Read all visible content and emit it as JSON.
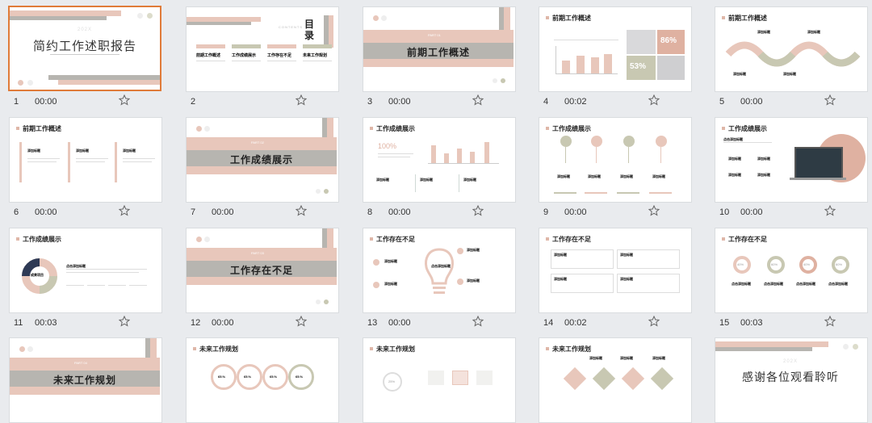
{
  "slides": [
    {
      "num": "1",
      "time": "00:00",
      "title": "简约工作述职报告",
      "year": "202X"
    },
    {
      "num": "2",
      "time": "",
      "title": "目录",
      "subtitle": "CONTENTS",
      "items": [
        "前期工作概述",
        "工作成绩展示",
        "工作存在不足",
        "未来工作规划"
      ],
      "tabs": [
        "01",
        "02",
        "03",
        "04"
      ]
    },
    {
      "num": "3",
      "time": "00:00",
      "title": "前期工作概述",
      "badge": "PART 01"
    },
    {
      "num": "4",
      "time": "00:02",
      "title": "前期工作概述",
      "pct1": "86%",
      "pct2": "53%"
    },
    {
      "num": "5",
      "time": "00:00",
      "title": "前期工作概述",
      "labels": [
        "添加标题",
        "添加标题",
        "添加标题",
        "添加标题"
      ]
    },
    {
      "num": "6",
      "time": "00:00",
      "title": "前期工作概述",
      "labels": [
        "添加标题",
        "添加标题",
        "添加标题"
      ]
    },
    {
      "num": "7",
      "time": "00:00",
      "title": "工作成绩展示",
      "badge": "PART 02"
    },
    {
      "num": "8",
      "time": "00:00",
      "title": "工作成绩展示",
      "big": "100%",
      "labels": [
        "添加标题",
        "添加标题",
        "添加标题"
      ]
    },
    {
      "num": "9",
      "time": "00:00",
      "title": "工作成绩展示",
      "labels": [
        "添加标题",
        "添加标题",
        "添加标题",
        "添加标题"
      ]
    },
    {
      "num": "10",
      "time": "00:00",
      "title": "工作成绩展示",
      "labels": [
        "点击添加标题",
        "添加标题",
        "添加标题",
        "添加标题",
        "添加标题"
      ]
    },
    {
      "num": "11",
      "time": "00:03",
      "title": "工作成绩展示",
      "center": "成果项目",
      "label": "点击添加标题"
    },
    {
      "num": "12",
      "time": "00:00",
      "title": "工作存在不足",
      "badge": "PART 03"
    },
    {
      "num": "13",
      "time": "00:00",
      "title": "工作存在不足",
      "center": "点击添加标题",
      "labels": [
        "添加标题",
        "添加标题",
        "添加标题",
        "添加标题"
      ]
    },
    {
      "num": "14",
      "time": "00:02",
      "title": "工作存在不足",
      "labels": [
        "添加标题",
        "添加标题",
        "添加标题",
        "添加标题"
      ]
    },
    {
      "num": "15",
      "time": "00:03",
      "title": "工作存在不足",
      "pcts": [
        "40%",
        "60%",
        "40%",
        "60%"
      ],
      "labels": [
        "点击添加标题",
        "点击添加标题",
        "点击添加标题",
        "点击添加标题"
      ]
    },
    {
      "num": "",
      "time": "",
      "title": "未来工作规划",
      "badge": "PART 04"
    },
    {
      "num": "",
      "time": "",
      "title": "未来工作规划",
      "pcts": [
        "65.%",
        "65.%",
        "65.%",
        "65.%"
      ]
    },
    {
      "num": "",
      "time": "",
      "title": "未来工作规划",
      "pct": "25%"
    },
    {
      "num": "",
      "time": "",
      "title": "未来工作规划",
      "labels": [
        "添加标题",
        "添加标题",
        "添加标题"
      ]
    },
    {
      "num": "",
      "time": "",
      "title": "感谢各位观看聆听",
      "year": "202X"
    }
  ],
  "colors": {
    "pink": "#e8c7bb",
    "gray": "#b7b5b0",
    "sage": "#c8c8b2",
    "select": "#e07b39"
  },
  "icons": {
    "star": "star-outline-icon"
  }
}
